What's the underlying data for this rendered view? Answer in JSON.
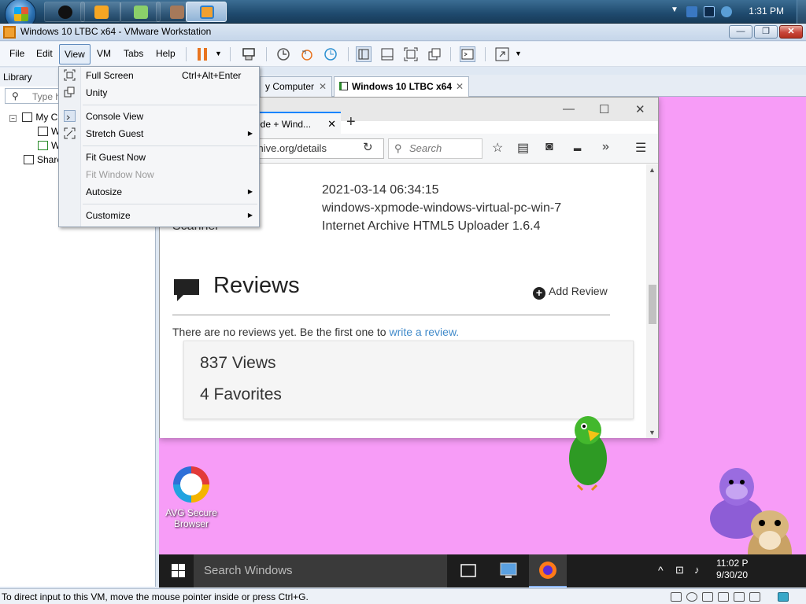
{
  "host": {
    "clock": "1:31 PM"
  },
  "window": {
    "title": "Windows 10 LTBC x64 - VMware Workstation"
  },
  "menubar": [
    "File",
    "Edit",
    "View",
    "VM",
    "Tabs",
    "Help"
  ],
  "library": {
    "title": "Library",
    "search_placeholder": "Type h",
    "tree": [
      "My C",
      "W",
      "W",
      "Share"
    ]
  },
  "tabs": {
    "inactive": "y Computer",
    "active": "Windows 10 LTBC x64"
  },
  "view_menu": {
    "items": [
      {
        "label": "Full Screen",
        "shortcut": "Ctrl+Alt+Enter",
        "icon": "full-screen-icon"
      },
      {
        "label": "Unity",
        "icon": "unity-icon"
      },
      {
        "label": "Console View",
        "icon": "console-view-icon"
      },
      {
        "label": "Stretch Guest",
        "icon": "stretch-guest-icon",
        "submenu": true
      },
      {
        "label": "Fit Guest Now"
      },
      {
        "label": "Fit Window Now",
        "disabled": true
      },
      {
        "label": "Autosize",
        "submenu": true
      },
      {
        "label": "Customize",
        "submenu": true
      }
    ]
  },
  "firefox": {
    "tab_title": "ode + Wind...",
    "url": "chive.org/details",
    "search_placeholder": "Search"
  },
  "page": {
    "scanner_label": "Scanner",
    "meta": [
      "2021-03-14 06:34:15",
      "windows-xpmode-windows-virtual-pc-win-7",
      "Internet Archive HTML5 Uploader 1.6.4"
    ],
    "reviews_title": "Reviews",
    "add_review": "Add Review",
    "no_reviews_text": "There are no reviews yet. Be the first one to ",
    "no_reviews_link": "write a review.",
    "views": "837 Views",
    "favorites": "4 Favorites"
  },
  "guest": {
    "avg_label": "AVG Secure Browser",
    "search_text": "Search Windows",
    "clock_time": "11:02 P",
    "clock_date": "9/30/20"
  },
  "status": {
    "message": "To direct input to this VM, move the mouse pointer inside or press Ctrl+G."
  },
  "colors": {
    "guest_desktop": "#f79cf7",
    "link": "#428bca"
  }
}
